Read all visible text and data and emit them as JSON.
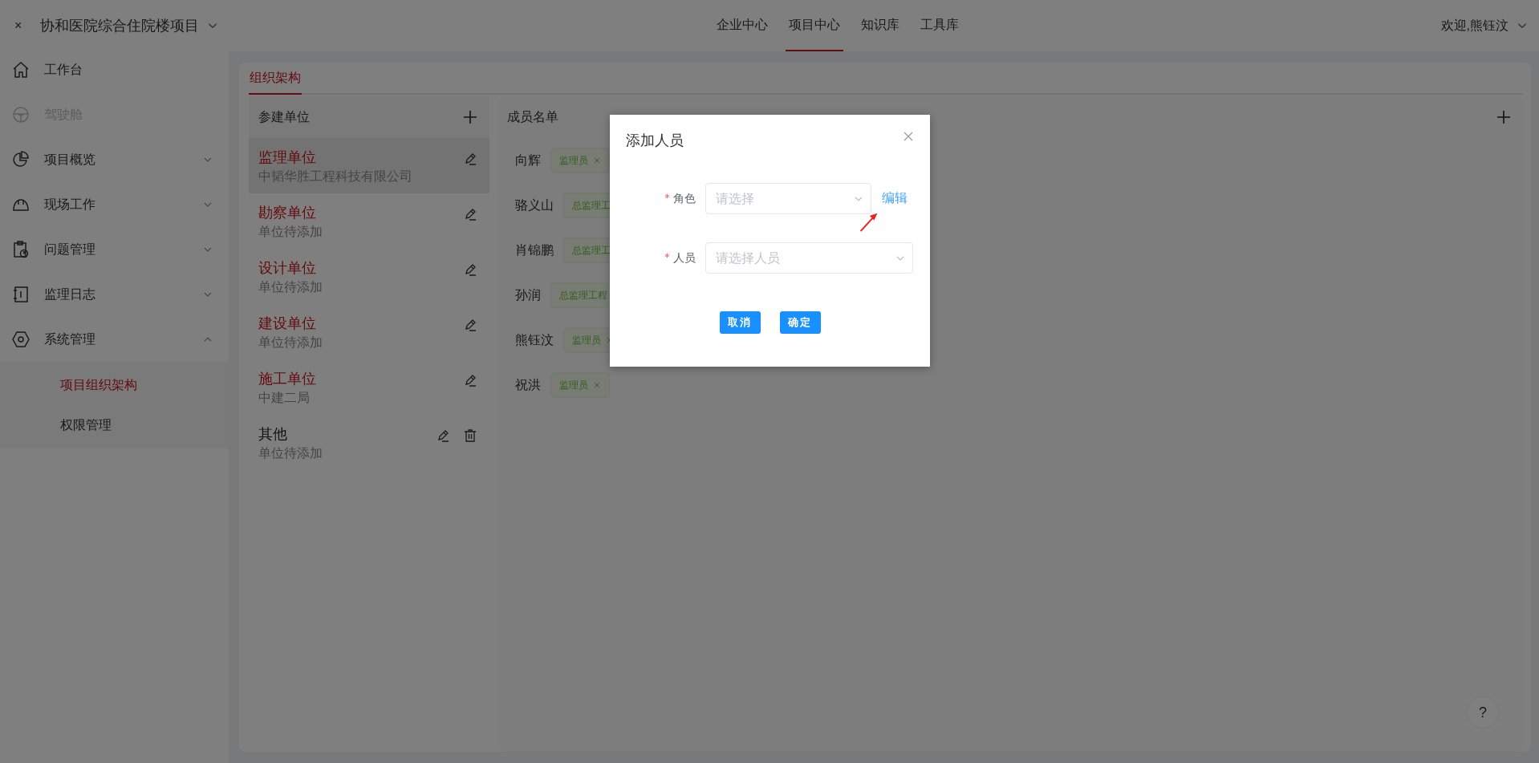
{
  "header": {
    "close_icon": "×",
    "project": "协和医院综合住院楼项目",
    "nav": [
      {
        "label": "企业中心",
        "selected": false
      },
      {
        "label": "项目中心",
        "selected": true
      },
      {
        "label": "知识库",
        "selected": false
      },
      {
        "label": "工具库",
        "selected": false
      }
    ],
    "user": "欢迎,熊钰汶"
  },
  "sidebar": {
    "items": [
      {
        "label": "工作台",
        "disabled": false
      },
      {
        "label": "驾驶舱",
        "disabled": true
      },
      {
        "label": "项目概览",
        "disabled": false,
        "expanded": false
      },
      {
        "label": "现场工作",
        "disabled": false,
        "expanded": false
      },
      {
        "label": "问题管理",
        "disabled": false,
        "expanded": false
      },
      {
        "label": "监理日志",
        "disabled": false,
        "expanded": false
      },
      {
        "label": "系统管理",
        "disabled": false,
        "expanded": true,
        "children": [
          {
            "label": "项目组织架构",
            "selected": true
          },
          {
            "label": "权限管理",
            "selected": false
          }
        ]
      }
    ]
  },
  "tabs": [
    {
      "label": "组织架构",
      "selected": true
    }
  ],
  "units": {
    "title": "参建单位",
    "items": [
      {
        "kind": "standard",
        "name": "监理单位",
        "company": "中韬华胜工程科技有限公司",
        "selected": true
      },
      {
        "kind": "standard",
        "name": "勘察单位",
        "company": "单位待添加",
        "selected": false
      },
      {
        "kind": "standard",
        "name": "设计单位",
        "company": "单位待添加",
        "selected": false
      },
      {
        "kind": "standard",
        "name": "建设单位",
        "company": "单位待添加",
        "selected": false
      },
      {
        "kind": "standard",
        "name": "施工单位",
        "company": "中建二局",
        "selected": false
      },
      {
        "kind": "custom",
        "name": "其他",
        "company": "单位待添加",
        "selected": false
      }
    ]
  },
  "members": {
    "title": "成员名单",
    "rows": [
      {
        "name": "向辉",
        "tag": "监理员",
        "closable": true
      },
      {
        "name": "骆义山",
        "tag": "总监理工",
        "closable": false
      },
      {
        "name": "肖锦鹏",
        "tag": "总监理工",
        "closable": false
      },
      {
        "name": "孙润",
        "tag": "总监理工程",
        "closable": false
      },
      {
        "name": "熊钰汶",
        "tag": "监理员",
        "closable": true
      },
      {
        "name": "祝洪",
        "tag": "监理员",
        "closable": true
      }
    ]
  },
  "dialog": {
    "title": "添加人员",
    "fields": [
      {
        "label": "角色",
        "required": true,
        "placeholder": "请选择",
        "link": "编辑"
      },
      {
        "label": "人员",
        "required": true,
        "placeholder": "请选择人员"
      }
    ],
    "buttons": [
      "取消",
      "确定"
    ]
  },
  "help": "?"
}
